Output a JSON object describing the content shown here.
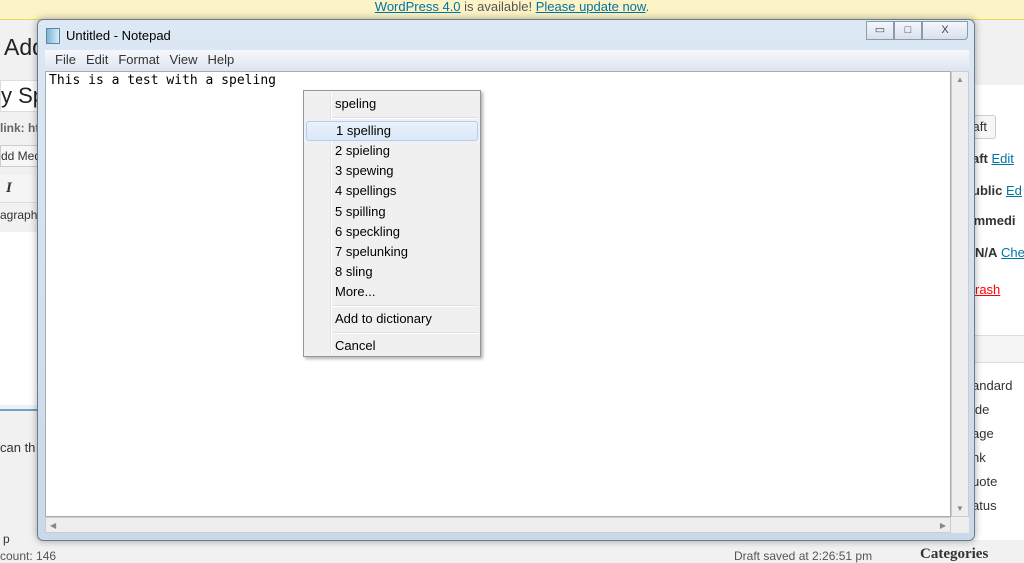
{
  "wp": {
    "notice": {
      "link1": "WordPress 4.0",
      "text": " is available! ",
      "link2": "Please update now",
      "end": "."
    },
    "left": {
      "heading": "Add",
      "post_title": "y Sp",
      "permalink": "link: ht",
      "add_media": "dd Med",
      "italic": "I",
      "format": "agraph",
      "content": "can th",
      "path": "p",
      "word_count": "count: 146"
    },
    "right": {
      "save_draft": "aft",
      "status_label": "aft",
      "status_edit": "Edit",
      "visibility_label": "ublic",
      "visibility_edit": "Ed",
      "publish_label": "immedi",
      "seo_label": "N/A",
      "seo_check": "Chec",
      "trash": "rash",
      "formats": [
        "andard",
        "ide",
        "age",
        "nk",
        "uote",
        "atus"
      ],
      "categories": "Categories"
    },
    "draft_saved": "Draft saved at 2:26:51 pm"
  },
  "notepad": {
    "title": "Untitled - Notepad",
    "menu": [
      "File",
      "Edit",
      "Format",
      "View",
      "Help"
    ],
    "text": "This is a test with a speling",
    "caption_buttons": {
      "minimize": "▭",
      "maximize": "□",
      "close": "X"
    }
  },
  "context_menu": {
    "word": "speling",
    "suggestions": [
      "1  spelling",
      "2  spieling",
      "3  spewing",
      "4  spellings",
      "5  spilling",
      "6  speckling",
      "7  spelunking",
      "8  sling"
    ],
    "more": "More...",
    "add": "Add to dictionary",
    "cancel": "Cancel"
  }
}
